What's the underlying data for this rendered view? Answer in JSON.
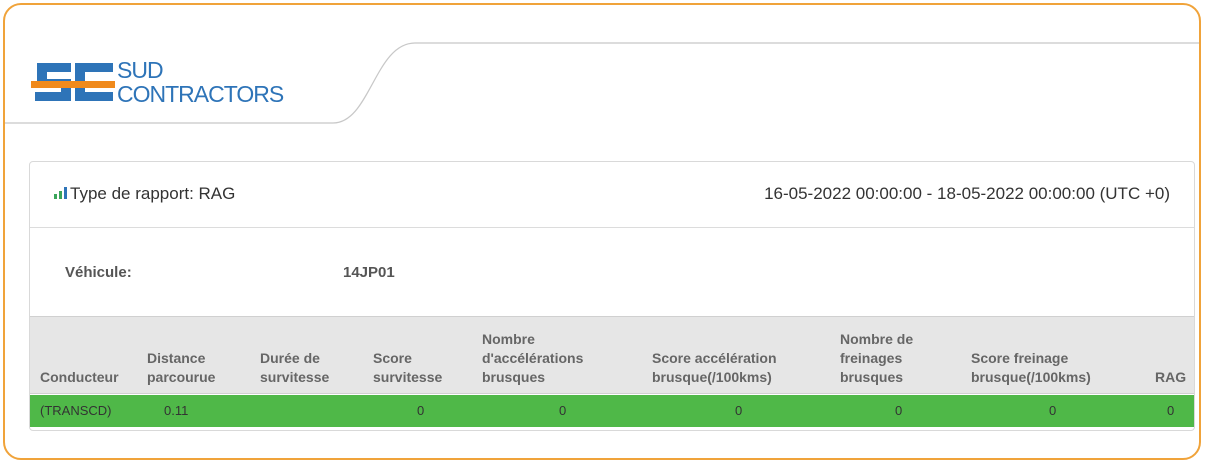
{
  "brand": {
    "line1": "SUD",
    "line2": "CONTRACTORS",
    "colors": {
      "blue": "#2e74b8",
      "orange": "#f08a1c"
    }
  },
  "report": {
    "label": "Type de rapport: RAG",
    "date_range": "16-05-2022 00:00:00 - 18-05-2022 00:00:00 (UTC +0)",
    "icon": "bar-chart-icon"
  },
  "vehicle": {
    "label": "Véhicule:",
    "value": "14JP01"
  },
  "table": {
    "headers": [
      "Conducteur",
      "Distance\nparcourue",
      "Durée de\nsurvitesse",
      "Score\nsurvitesse",
      "Nombre\nd'accélérations\nbrusques",
      "Score accélération\nbrusque(/100kms)",
      "Nombre de\nfreinages\nbrusques",
      "Score freinage\nbrusque(/100kms)",
      "RAG"
    ],
    "row": [
      "(TRANSCD)",
      "0.11",
      "",
      "0",
      "0",
      "0",
      "0",
      "0",
      "0"
    ],
    "row_color": "#4fb848"
  },
  "colors": {
    "frame_border": "#f0a33a",
    "header_bg": "#e6e6e6",
    "icon_green": "#3aa55a"
  }
}
